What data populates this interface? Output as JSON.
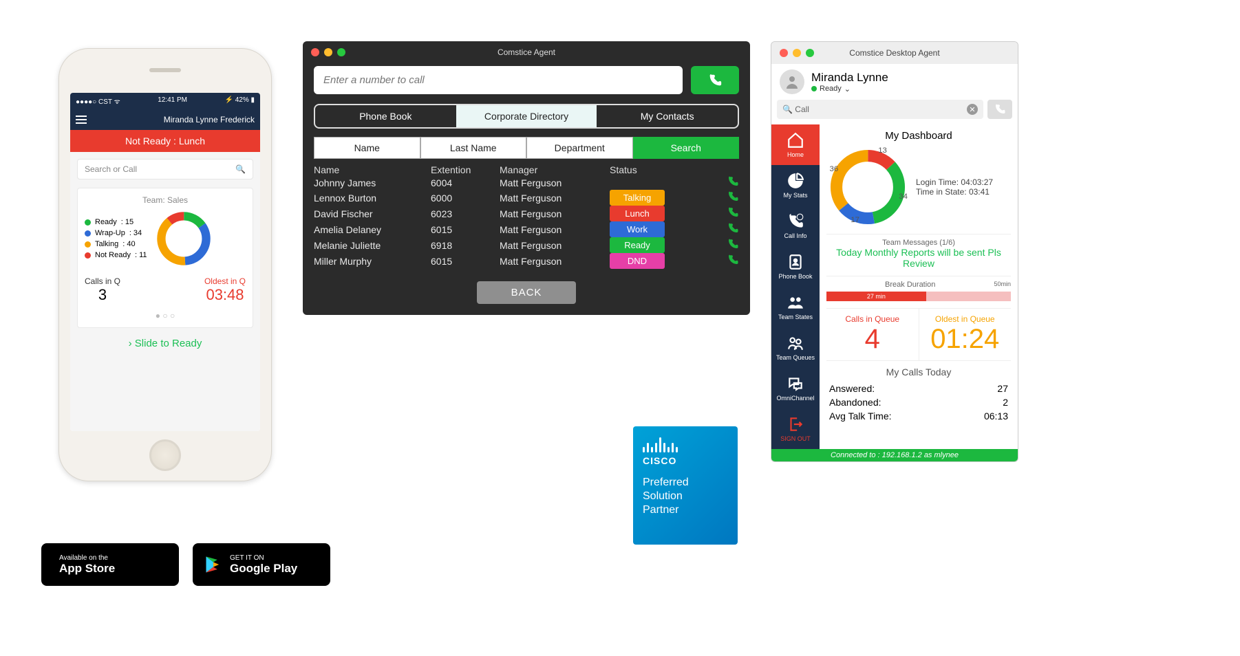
{
  "phone": {
    "statusbar": {
      "left": "●●●●○ CST ᯤ",
      "center": "12:41 PM",
      "right": "⚡ 42% ▮"
    },
    "appbar": {
      "username": "Miranda Lynne Frederick"
    },
    "redband": "Not Ready : Lunch",
    "search_placeholder": "Search or Call",
    "team_label": "Team: Sales",
    "legend": [
      {
        "label": "Ready",
        "value": 15,
        "color": "#1cb83f"
      },
      {
        "label": "Wrap-Up",
        "value": 34,
        "color": "#2e6bd6"
      },
      {
        "label": "Talking",
        "value": 40,
        "color": "#f6a300"
      },
      {
        "label": "Not Ready",
        "value": 11,
        "color": "#e83b2e"
      }
    ],
    "calls_in_q_label": "Calls in Q",
    "calls_in_q": "3",
    "oldest_label": "Oldest in Q",
    "oldest": "03:48",
    "slide": "Slide to Ready"
  },
  "badges": {
    "apple_small": "Available on the",
    "apple_big": "App Store",
    "google_small": "GET IT ON",
    "google_big": "Google Play"
  },
  "agent": {
    "title": "Comstice Agent",
    "call_placeholder": "Enter a number to call",
    "tabs": [
      "Phone Book",
      "Corporate Directory",
      "My Contacts"
    ],
    "filters": [
      "Name",
      "Last Name",
      "Department",
      "Search"
    ],
    "headers": {
      "name": "Name",
      "ext": "Extention",
      "mgr": "Manager",
      "stat": "Status"
    },
    "rows": [
      {
        "name": "Johnny James",
        "ext": "6004",
        "mgr": "Matt Ferguson",
        "status": "",
        "color": ""
      },
      {
        "name": "Lennox Burton",
        "ext": "6000",
        "mgr": "Matt Ferguson",
        "status": "Talking",
        "color": "#f6a300"
      },
      {
        "name": "David Fischer",
        "ext": "6023",
        "mgr": "Matt Ferguson",
        "status": "Lunch",
        "color": "#e83b2e"
      },
      {
        "name": "Amelia Delaney",
        "ext": "6015",
        "mgr": "Matt Ferguson",
        "status": "Work",
        "color": "#2e6bd6"
      },
      {
        "name": "Melanie Juliette",
        "ext": "6918",
        "mgr": "Matt Ferguson",
        "status": "Ready",
        "color": "#1cb83f"
      },
      {
        "name": "Miller Murphy",
        "ext": "6015",
        "mgr": "Matt Ferguson",
        "status": "DND",
        "color": "#e63fa7"
      }
    ],
    "back": "BACK"
  },
  "cisco": {
    "brand": "CISCO",
    "line1": "Preferred",
    "line2": "Solution",
    "line3": "Partner"
  },
  "desk": {
    "title": "Comstice Desktop Agent",
    "username": "Miranda Lynne",
    "status": "Ready",
    "search_value": "Call",
    "sidebar": [
      "Home",
      "My Stats",
      "Call Info",
      "Phone Book",
      "Team States",
      "Team Queues",
      "OmniChannel",
      "SIGN OUT"
    ],
    "dash_title": "My Dashboard",
    "login_time_label": "Login Time:",
    "login_time": "04:03:27",
    "state_time_label": "Time in State:",
    "state_time": "03:41",
    "ring": [
      {
        "label": "13",
        "color": "#e83b2e"
      },
      {
        "label": "34",
        "color": "#1cb83f"
      },
      {
        "label": "17",
        "color": "#2e6bd6"
      },
      {
        "label": "36",
        "color": "#f6a300"
      }
    ],
    "team_msg_label": "Team Messages (1/6)",
    "team_msg": "Today Monthly Reports will be sent Pls Review",
    "break_label": "Break Duration",
    "break_max": "50min",
    "break_cur": "27 min",
    "break_pct": 54,
    "calls_q_label": "Calls in Queue",
    "calls_q": "4",
    "oldest_q_label": "Oldest in Queue",
    "oldest_q": "01:24",
    "mycalls_title": "My Calls Today",
    "mycalls": [
      {
        "k": "Answered:",
        "v": "27"
      },
      {
        "k": "Abandoned:",
        "v": "2"
      },
      {
        "k": "Avg Talk Time:",
        "v": "06:13"
      }
    ],
    "footer": "Connected to : 192.168.1.2 as mlynee"
  },
  "chart_data": [
    {
      "type": "pie",
      "title": "Team: Sales",
      "series": [
        {
          "name": "Ready",
          "value": 15
        },
        {
          "name": "Wrap-Up",
          "value": 34
        },
        {
          "name": "Talking",
          "value": 40
        },
        {
          "name": "Not Ready",
          "value": 11
        }
      ]
    },
    {
      "type": "pie",
      "title": "My Dashboard",
      "series": [
        {
          "name": "segment-red",
          "value": 13
        },
        {
          "name": "segment-green",
          "value": 34
        },
        {
          "name": "segment-blue",
          "value": 17
        },
        {
          "name": "segment-orange",
          "value": 36
        }
      ]
    }
  ]
}
